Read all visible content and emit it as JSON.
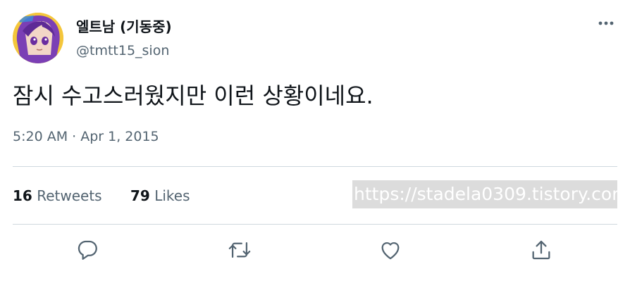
{
  "user": {
    "display_name": "엘트남 (기동중)",
    "handle": "@tmtt15_sion",
    "avatar_icon": "anime-avatar-icon"
  },
  "tweet": {
    "text": "잠시 수고스러웠지만 이런 상황이네요.",
    "timestamp": "5:20 AM · Apr 1, 2015"
  },
  "stats": {
    "retweets_count": "16",
    "retweets_label": "Retweets",
    "likes_count": "79",
    "likes_label": "Likes"
  },
  "watermark": "https://stadela0309.tistory.com",
  "actions": {
    "reply_icon": "reply-icon",
    "retweet_icon": "retweet-icon",
    "like_icon": "heart-icon",
    "share_icon": "share-icon"
  },
  "colors": {
    "text": "#0f1419",
    "secondary": "#536471",
    "divider": "#cfd9de",
    "action_icon": "#536471"
  }
}
